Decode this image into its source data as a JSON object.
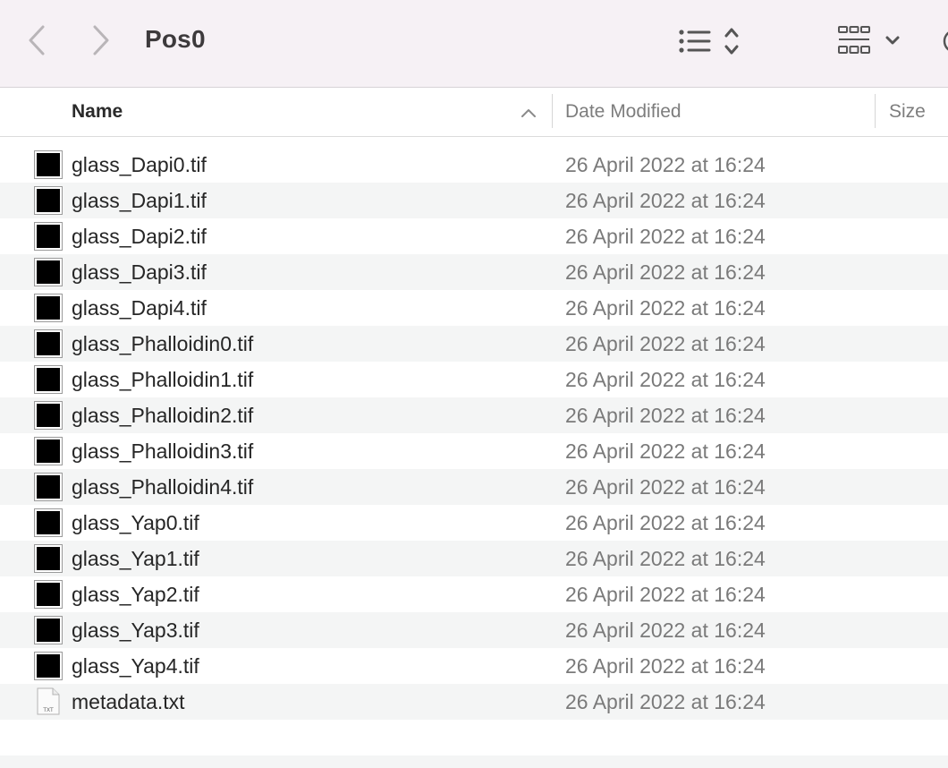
{
  "window": {
    "title": "Pos0"
  },
  "toolbar": {
    "back_icon": "chevron-left-icon",
    "forward_icon": "chevron-right-icon",
    "list_view_icon": "list-view-icon",
    "sort_icon": "up-down-chevron-icon",
    "group_icon": "icon-grid-icon",
    "group_dropdown_icon": "chevron-down-icon"
  },
  "columns": {
    "name": "Name",
    "date_modified": "Date Modified",
    "size": "Size"
  },
  "files": [
    {
      "name": "glass_Dapi0.tif",
      "date": "26 April 2022 at 16:24",
      "type": "tif"
    },
    {
      "name": "glass_Dapi1.tif",
      "date": "26 April 2022 at 16:24",
      "type": "tif"
    },
    {
      "name": "glass_Dapi2.tif",
      "date": "26 April 2022 at 16:24",
      "type": "tif"
    },
    {
      "name": "glass_Dapi3.tif",
      "date": "26 April 2022 at 16:24",
      "type": "tif"
    },
    {
      "name": "glass_Dapi4.tif",
      "date": "26 April 2022 at 16:24",
      "type": "tif"
    },
    {
      "name": "glass_Phalloidin0.tif",
      "date": "26 April 2022 at 16:24",
      "type": "tif"
    },
    {
      "name": "glass_Phalloidin1.tif",
      "date": "26 April 2022 at 16:24",
      "type": "tif"
    },
    {
      "name": "glass_Phalloidin2.tif",
      "date": "26 April 2022 at 16:24",
      "type": "tif"
    },
    {
      "name": "glass_Phalloidin3.tif",
      "date": "26 April 2022 at 16:24",
      "type": "tif"
    },
    {
      "name": "glass_Phalloidin4.tif",
      "date": "26 April 2022 at 16:24",
      "type": "tif"
    },
    {
      "name": "glass_Yap0.tif",
      "date": "26 April 2022 at 16:24",
      "type": "tif"
    },
    {
      "name": "glass_Yap1.tif",
      "date": "26 April 2022 at 16:24",
      "type": "tif"
    },
    {
      "name": "glass_Yap2.tif",
      "date": "26 April 2022 at 16:24",
      "type": "tif"
    },
    {
      "name": "glass_Yap3.tif",
      "date": "26 April 2022 at 16:24",
      "type": "tif"
    },
    {
      "name": "glass_Yap4.tif",
      "date": "26 April 2022 at 16:24",
      "type": "tif"
    },
    {
      "name": "metadata.txt",
      "date": "26 April 2022 at 16:24",
      "type": "txt"
    }
  ],
  "txt_icon_label": "TXT",
  "colors": {
    "toolbar_bg": "#f6f1f5",
    "row_alt": "#f4f5f5",
    "secondary_text": "#7a7a7a"
  }
}
